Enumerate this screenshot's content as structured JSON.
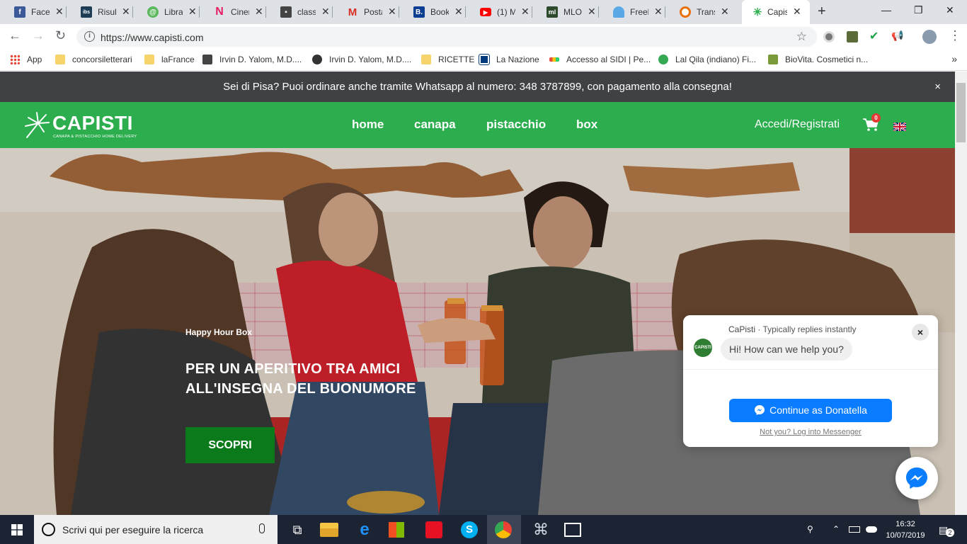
{
  "browser": {
    "tabs": [
      {
        "label": "Faceb",
        "icon": "facebook-icon",
        "color": "#3b5998",
        "glyph": "f"
      },
      {
        "label": "Risult",
        "icon": "ibs-icon",
        "color": "#1d3d56",
        "glyph": "ibs"
      },
      {
        "label": "Libra",
        "icon": "libraccio-icon",
        "color": "#5cb85c",
        "glyph": "@"
      },
      {
        "label": "Cinen",
        "icon": "cinema-icon",
        "color": "#e91e63",
        "glyph": "N"
      },
      {
        "label": "classr",
        "icon": "classroom-icon",
        "color": "#444444",
        "glyph": "■"
      },
      {
        "label": "Posta",
        "icon": "gmail-icon",
        "color": "#d93025",
        "glyph": "M"
      },
      {
        "label": "Booki",
        "icon": "booking-icon",
        "color": "#0b3d91",
        "glyph": "B."
      },
      {
        "label": "(1) M",
        "icon": "youtube-icon",
        "color": "#ff0000",
        "glyph": "▶"
      },
      {
        "label": "MLOL",
        "icon": "mlol-icon",
        "color": "#2d4a2d",
        "glyph": "ml"
      },
      {
        "label": "Freela",
        "icon": "freelancer-icon",
        "color": "#5aa9e6",
        "glyph": "⌒"
      },
      {
        "label": "Transl",
        "icon": "translate-icon",
        "color": "#e8710a",
        "glyph": "◉"
      },
      {
        "label": "Capis",
        "icon": "capisti-tab-icon",
        "color": "#2cad4e",
        "glyph": "✳"
      }
    ],
    "new_tab": "+",
    "window_controls": {
      "minimize": "—",
      "maximize": "❐",
      "close": "✕"
    },
    "url": "https://www.capisti.com",
    "bookmarks": [
      {
        "label": "App",
        "color": "#ea4335"
      },
      {
        "label": "concorsiletterari",
        "color": "#f6d36b"
      },
      {
        "label": "laFrance",
        "color": "#f6d36b"
      },
      {
        "label": "Irvin D. Yalom, M.D....",
        "color": "#444444"
      },
      {
        "label": "Irvin D. Yalom, M.D....",
        "color": "#333333"
      },
      {
        "label": "RICETTE",
        "color": "#f6d36b"
      },
      {
        "label": "La Nazione",
        "color": "#003c7e"
      },
      {
        "label": "Accesso al SIDI | Pe...",
        "color": "#e74c3c"
      },
      {
        "label": "Lal Qila (indiano) Fi...",
        "color": "#34a853"
      },
      {
        "label": "BioVita. Cosmetici n...",
        "color": "#7a9a3a"
      }
    ],
    "bookmarks_more": "»"
  },
  "site": {
    "notice": "Sei di Pisa? Puoi ordinare anche tramite Whatsapp al numero: 348 3787899, con pagamento alla consegna!",
    "notice_close": "×",
    "logo_word": "CAPISTI",
    "logo_tagline": "CANAPA & PISTACCHIO HOME DELIVERY",
    "menu": [
      "home",
      "canapa",
      "pistacchio",
      "box"
    ],
    "login": "Accedi/Registrati",
    "cart_count": "0",
    "hero": {
      "eyebrow": "Happy Hour Box",
      "title_line1": "PER UN APERITIVO TRA AMICI",
      "title_line2": "ALL'INSEGNA DEL BUONUMORE",
      "cta": "SCOPRI"
    },
    "chat": {
      "page_name": "CaPisti",
      "status": " · Typically replies instantly",
      "avatar_text": "CAPISTI",
      "greeting": "Hi! How can we help you?",
      "continue": "Continue as Donatella",
      "not_you": "Not you? Log into Messenger",
      "close": "×"
    }
  },
  "taskbar": {
    "search_placeholder": "Scrivi qui per eseguire la ricerca",
    "time": "16:32",
    "date": "10/07/2019",
    "notifications": "2"
  },
  "colors": {
    "brand_green": "#2cad4e",
    "cta_green": "#0a7a1b",
    "notice_bg": "#3f4145",
    "messenger_blue": "#0a7cff"
  }
}
